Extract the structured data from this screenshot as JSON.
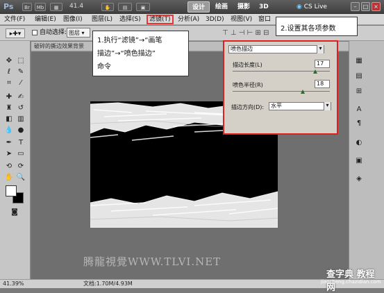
{
  "app": {
    "logo": "Ps",
    "br_label": "Br",
    "mb_label": "Mb",
    "zoom": "41.4",
    "cs_live": "CS Live"
  },
  "workspaces": [
    "设计",
    "绘画",
    "摄影",
    "3D"
  ],
  "menu": [
    "文件(F)",
    "编辑(E)",
    "图像(I)",
    "图层(L)",
    "选择(S)",
    "滤镜(T)",
    "分析(A)",
    "3D(D)",
    "视图(V)",
    "窗口"
  ],
  "options_bar": {
    "auto_select_label": "自动选择:",
    "auto_select_value": "图层"
  },
  "doc_tab": {
    "title": "破碎的撕边效果背景"
  },
  "callout1": {
    "line1": "1.执行“滤镜”→“画笔",
    "line2": "描边”→“喷色描边”",
    "line3": "命令"
  },
  "callout2": {
    "text": "2.设置其各项参数"
  },
  "dialog": {
    "filter_select": "喷色描边",
    "stroke_length_label": "描边长度(L)",
    "stroke_length_value": "17",
    "stroke_length_level": 0.85,
    "spray_radius_label": "喷色半径(R)",
    "spray_radius_value": "18",
    "spray_radius_level": 0.72,
    "direction_label": "描边方向(D):",
    "direction_value": "水平"
  },
  "status": {
    "zoom": "41.39%",
    "doc": "文档:1.70M/4.93M"
  },
  "watermarks": {
    "main": "腾龍視覺WWW.TLVI.NET",
    "corner": "查字典 教程 网",
    "corner_url": "jiaocheng.chazidian.com"
  },
  "colors": {
    "highlight": "#e02020",
    "titlebar": "#4a4a4a",
    "menubar": "#d8d8d8"
  }
}
